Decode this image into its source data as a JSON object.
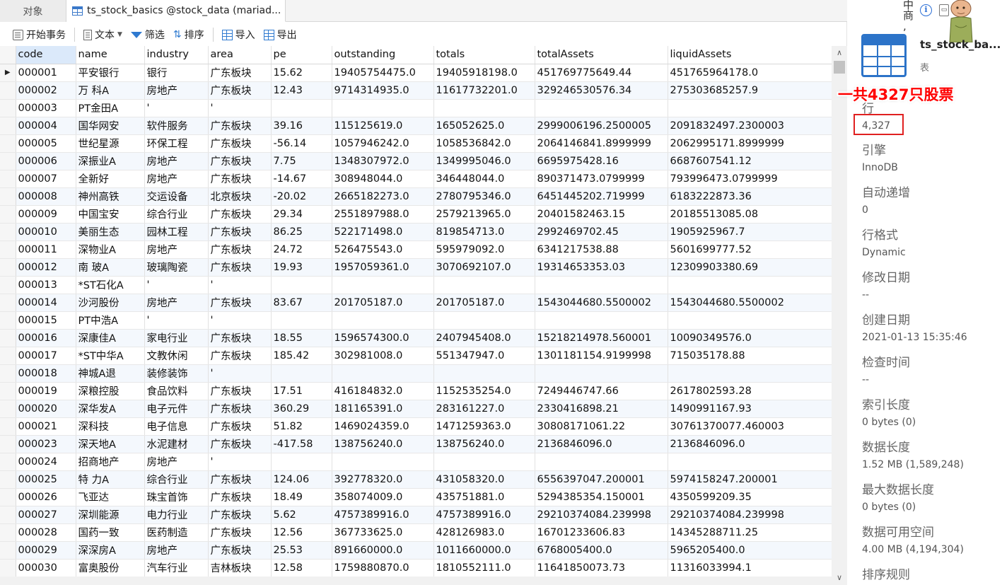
{
  "tabs": {
    "objects": "对象",
    "table": "ts_stock_basics @stock_data (mariad..."
  },
  "toolbar": {
    "begin_transaction": "开始事务",
    "text": "文本",
    "filter": "筛选",
    "sort": "排序",
    "import": "导入",
    "export": "导出"
  },
  "grid": {
    "columns": [
      "code",
      "name",
      "industry",
      "area",
      "pe",
      "outstanding",
      "totals",
      "totalAssets",
      "liquidAssets"
    ],
    "rows": [
      [
        "000001",
        "平安银行",
        "银行",
        "广东板块",
        "15.62",
        "19405754475.0",
        "19405918198.0",
        "451769775649.44",
        "451765964178.0"
      ],
      [
        "000002",
        "万 科A",
        "房地产",
        "广东板块",
        "12.43",
        "9714314935.0",
        "11617732201.0",
        "329246530576.34",
        "275303685257.9"
      ],
      [
        "000003",
        "PT金田A",
        "'",
        "'",
        "",
        "",
        "",
        "",
        ""
      ],
      [
        "000004",
        "国华网安",
        "软件服务",
        "广东板块",
        "39.16",
        "115125619.0",
        "165052625.0",
        "2999006196.2500005",
        "2091832497.2300003"
      ],
      [
        "000005",
        "世纪星源",
        "环保工程",
        "广东板块",
        "-56.14",
        "1057946242.0",
        "1058536842.0",
        "2064146841.8999999",
        "2062995171.8999999"
      ],
      [
        "000006",
        "深振业A",
        "房地产",
        "广东板块",
        "7.75",
        "1348307972.0",
        "1349995046.0",
        "6695975428.16",
        "6687607541.12"
      ],
      [
        "000007",
        "全新好",
        "房地产",
        "广东板块",
        "-14.67",
        "308948044.0",
        "346448044.0",
        "890371473.0799999",
        "793996473.0799999"
      ],
      [
        "000008",
        "神州高铁",
        "交运设备",
        "北京板块",
        "-20.02",
        "2665182273.0",
        "2780795346.0",
        "6451445202.719999",
        "6183222873.36"
      ],
      [
        "000009",
        "中国宝安",
        "综合行业",
        "广东板块",
        "29.34",
        "2551897988.0",
        "2579213965.0",
        "20401582463.15",
        "20185513085.08"
      ],
      [
        "000010",
        "美丽生态",
        "园林工程",
        "广东板块",
        "86.25",
        "522171498.0",
        "819854713.0",
        "2992469702.45",
        "1905925967.7"
      ],
      [
        "000011",
        "深物业A",
        "房地产",
        "广东板块",
        "24.72",
        "526475543.0",
        "595979092.0",
        "6341217538.88",
        "5601699777.52"
      ],
      [
        "000012",
        "南 玻A",
        "玻璃陶瓷",
        "广东板块",
        "19.93",
        "1957059361.0",
        "3070692107.0",
        "19314653353.03",
        "12309903380.69"
      ],
      [
        "000013",
        "*ST石化A",
        "'",
        "'",
        "",
        "",
        "",
        "",
        ""
      ],
      [
        "000014",
        "沙河股份",
        "房地产",
        "广东板块",
        "83.67",
        "201705187.0",
        "201705187.0",
        "1543044680.5500002",
        "1543044680.5500002"
      ],
      [
        "000015",
        "PT中浩A",
        "'",
        "'",
        "",
        "",
        "",
        "",
        ""
      ],
      [
        "000016",
        "深康佳A",
        "家电行业",
        "广东板块",
        "18.55",
        "1596574300.0",
        "2407945408.0",
        "15218214978.560001",
        "10090349576.0"
      ],
      [
        "000017",
        "*ST中华A",
        "文教休闲",
        "广东板块",
        "185.42",
        "302981008.0",
        "551347947.0",
        "1301181154.9199998",
        "715035178.88"
      ],
      [
        "000018",
        "神城A退",
        "装修装饰",
        "'",
        "",
        "",
        "",
        "",
        ""
      ],
      [
        "000019",
        "深粮控股",
        "食品饮料",
        "广东板块",
        "17.51",
        "416184832.0",
        "1152535254.0",
        "7249446747.66",
        "2617802593.28"
      ],
      [
        "000020",
        "深华发A",
        "电子元件",
        "广东板块",
        "360.29",
        "181165391.0",
        "283161227.0",
        "2330416898.21",
        "1490991167.93"
      ],
      [
        "000021",
        "深科技",
        "电子信息",
        "广东板块",
        "51.82",
        "1469024359.0",
        "1471259363.0",
        "30808171061.22",
        "30761370077.460003"
      ],
      [
        "000023",
        "深天地A",
        "水泥建材",
        "广东板块",
        "-417.58",
        "138756240.0",
        "138756240.0",
        "2136846096.0",
        "2136846096.0"
      ],
      [
        "000024",
        "招商地产",
        "房地产",
        "'",
        "",
        "",
        "",
        "",
        ""
      ],
      [
        "000025",
        "特 力A",
        "综合行业",
        "广东板块",
        "124.06",
        "392778320.0",
        "431058320.0",
        "6556397047.200001",
        "5974158247.200001"
      ],
      [
        "000026",
        "飞亚达",
        "珠宝首饰",
        "广东板块",
        "18.49",
        "358074009.0",
        "435751881.0",
        "5294385354.150001",
        "4350599209.35"
      ],
      [
        "000027",
        "深圳能源",
        "电力行业",
        "广东板块",
        "5.62",
        "4757389916.0",
        "4757389916.0",
        "29210374084.239998",
        "29210374084.239998"
      ],
      [
        "000028",
        "国药一致",
        "医药制造",
        "广东板块",
        "12.56",
        "367733625.0",
        "428126983.0",
        "16701233606.83",
        "14345288711.25"
      ],
      [
        "000029",
        "深深房A",
        "房地产",
        "广东板块",
        "25.53",
        "891660000.0",
        "1011660000.0",
        "6768005400.0",
        "5965205400.0"
      ],
      [
        "000030",
        "富奥股份",
        "汽车行业",
        "吉林板块",
        "12.58",
        "1759880870.0",
        "1810552111.0",
        "11641850073.73",
        "11316033994.1"
      ]
    ]
  },
  "right_panel": {
    "top_chars": "中\n商\n,",
    "info_glyph": "i",
    "object_name": "ts_stock_ba...",
    "object_type": "表",
    "annotation": "一共4327只股票",
    "properties": [
      {
        "label": "行",
        "value": "4,327"
      },
      {
        "label": "引擎",
        "value": "InnoDB"
      },
      {
        "label": "自动递增",
        "value": "0"
      },
      {
        "label": "行格式",
        "value": "Dynamic"
      },
      {
        "label": "修改日期",
        "value": "--"
      },
      {
        "label": "创建日期",
        "value": "2021-01-13 15:35:46"
      },
      {
        "label": "检查时间",
        "value": "--"
      },
      {
        "label": "索引长度",
        "value": "0 bytes (0)"
      },
      {
        "label": "数据长度",
        "value": "1.52 MB (1,589,248)"
      },
      {
        "label": "最大数据长度",
        "value": "0 bytes (0)"
      },
      {
        "label": "数据可用空间",
        "value": "4.00 MB (4,194,304)"
      },
      {
        "label": "排序规则",
        "value": ""
      }
    ]
  },
  "colors": {
    "selected_header": "#dbe9fa",
    "alt_row": "#f4f8fd",
    "accent_blue": "#2c73c8",
    "annotation_red": "#ff0000"
  }
}
